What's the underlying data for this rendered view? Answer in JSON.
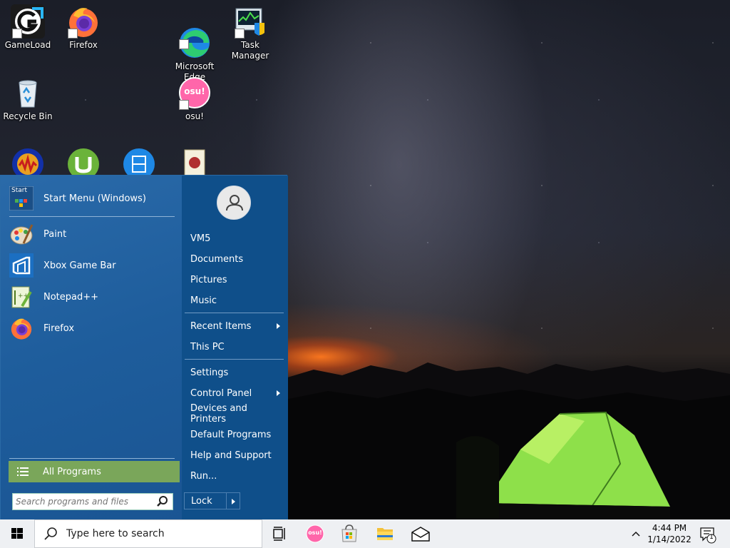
{
  "desktop": {
    "icons": [
      {
        "label": "GameLoad"
      },
      {
        "label": "Firefox"
      },
      {
        "label": "Microsoft\nEdge"
      },
      {
        "label": "Task Manager"
      },
      {
        "label": "Recycle Bin"
      },
      {
        "label": "osu!"
      }
    ],
    "osu_badge": "osu!"
  },
  "start_menu": {
    "top_item": {
      "label": "Start Menu (Windows)",
      "icon": "start-menu-icon",
      "icon_text": "Start"
    },
    "pinned": [
      {
        "label": "Paint",
        "icon": "paint-icon"
      },
      {
        "label": "Xbox Game Bar",
        "icon": "xbox-game-bar-icon"
      },
      {
        "label": "Notepad++",
        "icon": "notepad-plus-plus-icon"
      },
      {
        "label": "Firefox",
        "icon": "firefox-icon"
      }
    ],
    "all_programs": "All Programs",
    "search_placeholder": "Search programs and files",
    "right": {
      "user": "VM5",
      "group1": [
        "Documents",
        "Pictures",
        "Music"
      ],
      "recent_items": "Recent Items",
      "this_pc": "This PC",
      "settings": "Settings",
      "control_panel": "Control Panel",
      "devices_and_printers": "Devices and Printers",
      "default_programs": "Default Programs",
      "help_and_support": "Help and Support",
      "run": "Run...",
      "lock": "Lock"
    },
    "colors": {
      "left_panel": "#1e5d9c",
      "right_panel": "#0f4f8a",
      "all_programs_bg": "#7aa65a"
    }
  },
  "taskbar": {
    "search_placeholder": "Type here to search",
    "osu_badge": "osu!",
    "time": "4:44 PM",
    "date": "1/14/2022",
    "notification_count": "1"
  }
}
